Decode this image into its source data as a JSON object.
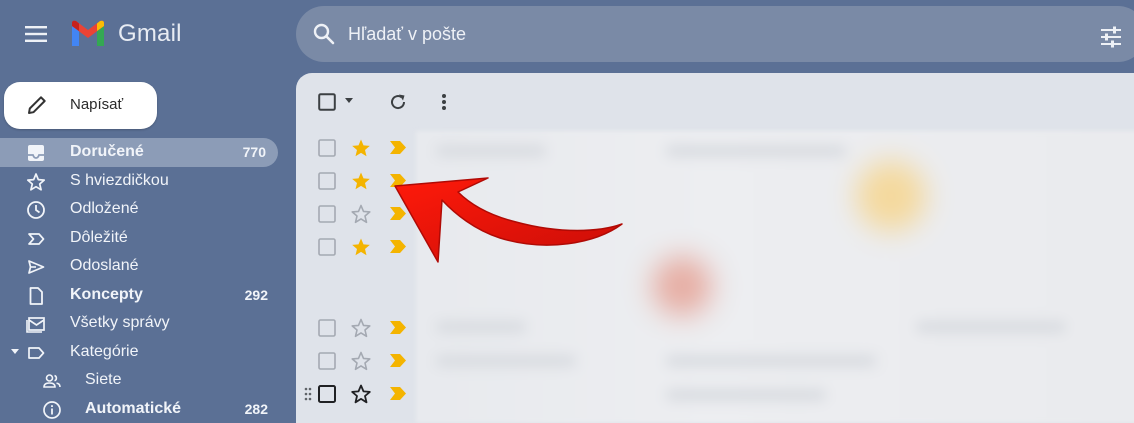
{
  "app": {
    "name": "Gmail"
  },
  "search": {
    "placeholder": "Hľadať v pošte"
  },
  "compose": {
    "label": "Napísať"
  },
  "nav": [
    {
      "label": "Doručené",
      "count": "770",
      "icon": "inbox-icon",
      "bold": true,
      "active": true
    },
    {
      "label": "S hviezdičkou",
      "count": "",
      "icon": "star-outline-icon"
    },
    {
      "label": "Odložené",
      "count": "",
      "icon": "clock-icon"
    },
    {
      "label": "Dôležité",
      "count": "",
      "icon": "important-outline-icon"
    },
    {
      "label": "Odoslané",
      "count": "",
      "icon": "send-icon"
    },
    {
      "label": "Koncepty",
      "count": "292",
      "icon": "draft-icon",
      "bold": true
    },
    {
      "label": "Všetky správy",
      "count": "",
      "icon": "all-mail-icon"
    },
    {
      "label": "Kategórie",
      "count": "",
      "icon": "label-icon"
    },
    {
      "label": "Siete",
      "count": "",
      "icon": "people-icon",
      "sub": true
    },
    {
      "label": "Automatické",
      "count": "282",
      "icon": "info-icon",
      "sub": true,
      "bold": true
    }
  ],
  "colors": {
    "background": "#5b7095",
    "star": "#f4b400",
    "important": "#f4b400",
    "arrow": "#e3120b"
  },
  "rows": [
    {
      "starred": true,
      "important": true
    },
    {
      "starred": true,
      "important": true
    },
    {
      "starred": false,
      "important": true
    },
    {
      "starred": true,
      "important": true
    },
    {
      "starred": false,
      "important": true
    },
    {
      "starred": false,
      "important": true
    },
    {
      "starred": false,
      "important": true
    }
  ]
}
